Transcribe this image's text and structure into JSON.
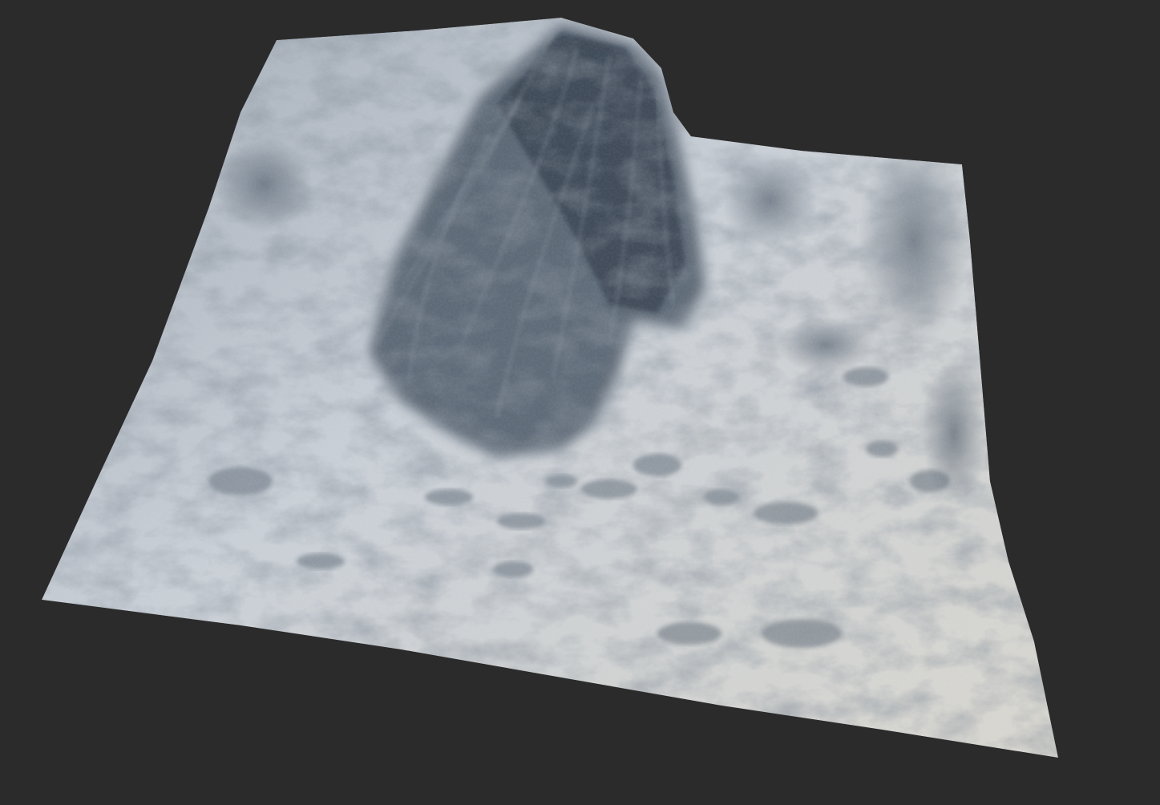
{
  "viewport": {
    "background_color": "#2b2b2b"
  },
  "terrain": {
    "surface_light_color": "#c9cfd6",
    "surface_mid_color": "#a4adb8",
    "surface_shadow_color": "#4e5a68",
    "surface_deep_shadow_color": "#3a4452",
    "surface_warm_highlight_color": "#d8d6cf"
  }
}
